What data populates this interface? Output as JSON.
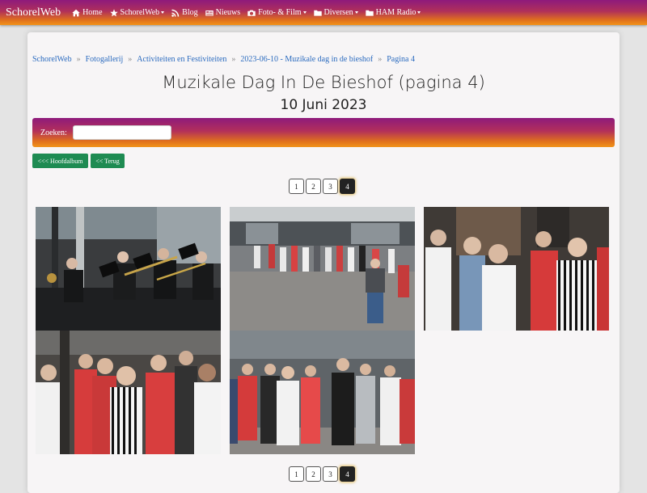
{
  "navbar": {
    "brand": "SchorelWeb",
    "items": [
      {
        "label": "Home",
        "icon": "home-icon",
        "dropdown": false
      },
      {
        "label": "SchorelWeb",
        "icon": "star-icon",
        "dropdown": true
      },
      {
        "label": "Blog",
        "icon": "rss-icon",
        "dropdown": false
      },
      {
        "label": "Nieuws",
        "icon": "newspaper-icon",
        "dropdown": false
      },
      {
        "label": "Foto- & Film",
        "icon": "camera-icon",
        "dropdown": true
      },
      {
        "label": "Diversen",
        "icon": "folder-icon",
        "dropdown": true
      },
      {
        "label": "HAM Radio",
        "icon": "folder-icon",
        "dropdown": true
      }
    ]
  },
  "breadcrumb": [
    "SchorelWeb",
    "Fotogallerij",
    "Activiteiten en Festiviteiten",
    "2023-06-10 - Muzikale dag in de bieshof",
    "Pagina 4"
  ],
  "breadcrumb_sep": "»",
  "page": {
    "title": "Muzikale Dag In De Bieshof (pagina 4)",
    "subtitle": "10 Juni 2023"
  },
  "search": {
    "label": "Zoeken:",
    "value": ""
  },
  "buttons": {
    "main_album": "<<< Hoofdalbum",
    "back": "<< Terug"
  },
  "pagination": {
    "pages": [
      "1",
      "2",
      "3",
      "4"
    ],
    "current": "4"
  },
  "colors": {
    "accent_start": "#8e1a7c",
    "accent_end": "#f2931a",
    "button_green": "#1e8b52",
    "link": "#2b6bbf"
  },
  "photos": [
    {
      "subject": "band-brass-section"
    },
    {
      "subject": "choir-in-square"
    },
    {
      "subject": "choir-singers-closeup"
    },
    {
      "subject": "choir-singers-closeup-2"
    },
    {
      "subject": "choir-group"
    }
  ]
}
